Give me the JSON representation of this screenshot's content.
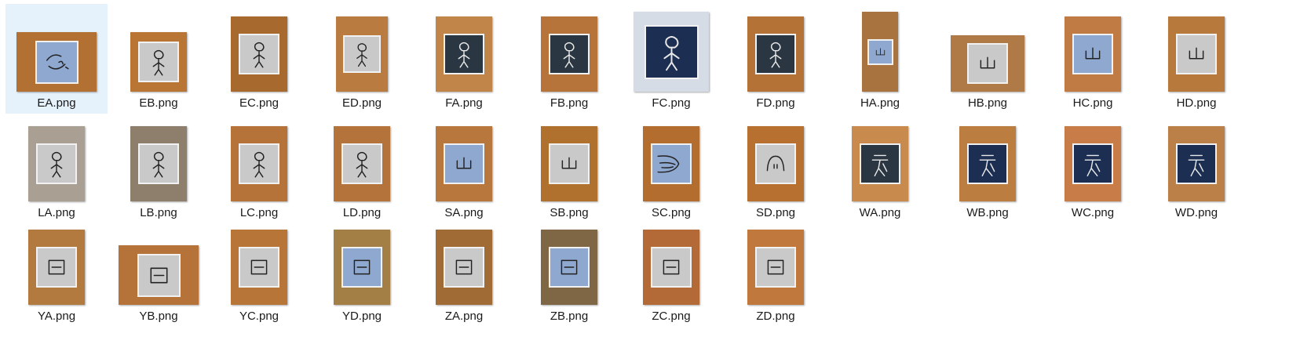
{
  "files": [
    {
      "name": "EA.png",
      "selected": true,
      "icon": "glyph-swirl-icon",
      "paper": "blue"
    },
    {
      "name": "EB.png",
      "icon": "glyph-figure-icon",
      "paper": "gray"
    },
    {
      "name": "EC.png",
      "icon": "glyph-figure-icon",
      "paper": "gray"
    },
    {
      "name": "ED.png",
      "icon": "glyph-figure-icon",
      "paper": "gray"
    },
    {
      "name": "FA.png",
      "icon": "glyph-figure-icon",
      "paper": "dark"
    },
    {
      "name": "FB.png",
      "icon": "glyph-figure-icon",
      "paper": "dark"
    },
    {
      "name": "FC.png",
      "icon": "glyph-figure-icon",
      "paper": "navy"
    },
    {
      "name": "FD.png",
      "icon": "glyph-figure-icon",
      "paper": "dark"
    },
    {
      "name": "HA.png",
      "icon": "glyph-mountain-icon",
      "paper": "blue"
    },
    {
      "name": "HB.png",
      "icon": "glyph-mountain-icon",
      "paper": "gray"
    },
    {
      "name": "HC.png",
      "icon": "glyph-mountain-icon",
      "paper": "blue"
    },
    {
      "name": "HD.png",
      "icon": "glyph-mountain-icon",
      "paper": "gray"
    },
    {
      "name": "LA.png",
      "icon": "glyph-figure-icon",
      "paper": "gray"
    },
    {
      "name": "LB.png",
      "icon": "glyph-figure-icon",
      "paper": "gray"
    },
    {
      "name": "LC.png",
      "icon": "glyph-figure-icon",
      "paper": "gray"
    },
    {
      "name": "LD.png",
      "icon": "glyph-figure-icon",
      "paper": "gray"
    },
    {
      "name": "SA.png",
      "icon": "glyph-mountain-icon",
      "paper": "blue"
    },
    {
      "name": "SB.png",
      "icon": "glyph-mountain-icon",
      "paper": "gray"
    },
    {
      "name": "SC.png",
      "icon": "glyph-claw-icon",
      "paper": "blue"
    },
    {
      "name": "SD.png",
      "icon": "glyph-arch-icon",
      "paper": "gray"
    },
    {
      "name": "WA.png",
      "icon": "glyph-tree-icon",
      "paper": "dark"
    },
    {
      "name": "WB.png",
      "icon": "glyph-tree-icon",
      "paper": "navy"
    },
    {
      "name": "WC.png",
      "icon": "glyph-tree-icon",
      "paper": "navy"
    },
    {
      "name": "WD.png",
      "icon": "glyph-tree-icon",
      "paper": "navy"
    },
    {
      "name": "YA.png",
      "icon": "glyph-box-icon",
      "paper": "gray"
    },
    {
      "name": "YB.png",
      "icon": "glyph-box-icon",
      "paper": "gray"
    },
    {
      "name": "YC.png",
      "icon": "glyph-box-icon",
      "paper": "gray"
    },
    {
      "name": "YD.png",
      "icon": "glyph-box-icon",
      "paper": "blue"
    },
    {
      "name": "ZA.png",
      "icon": "glyph-box-icon",
      "paper": "gray"
    },
    {
      "name": "ZB.png",
      "icon": "glyph-box-icon",
      "paper": "blue"
    },
    {
      "name": "ZC.png",
      "icon": "glyph-box-icon",
      "paper": "gray"
    },
    {
      "name": "ZD.png",
      "icon": "glyph-box-icon",
      "paper": "gray"
    }
  ]
}
